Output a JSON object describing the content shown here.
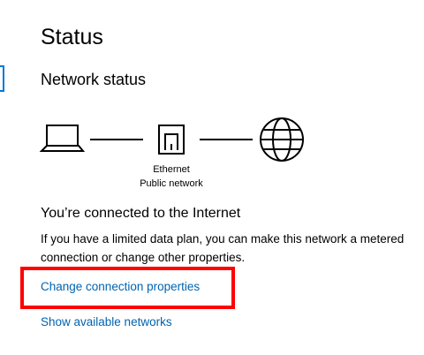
{
  "page": {
    "title": "Status",
    "section_title": "Network status"
  },
  "diagram": {
    "adapter_name": "Ethernet",
    "network_type": "Public network",
    "icons": [
      "laptop-icon",
      "ethernet-icon",
      "globe-icon"
    ]
  },
  "connection": {
    "status_title": "You’re connected to the Internet",
    "description": "If you have a limited data plan, you can make this network a metered connection or change other properties."
  },
  "links": {
    "change_properties": "Change connection properties",
    "show_networks": "Show available networks"
  },
  "colors": {
    "link": "#0063b1",
    "highlight": "#ff0000",
    "accent": "#0078d7"
  }
}
